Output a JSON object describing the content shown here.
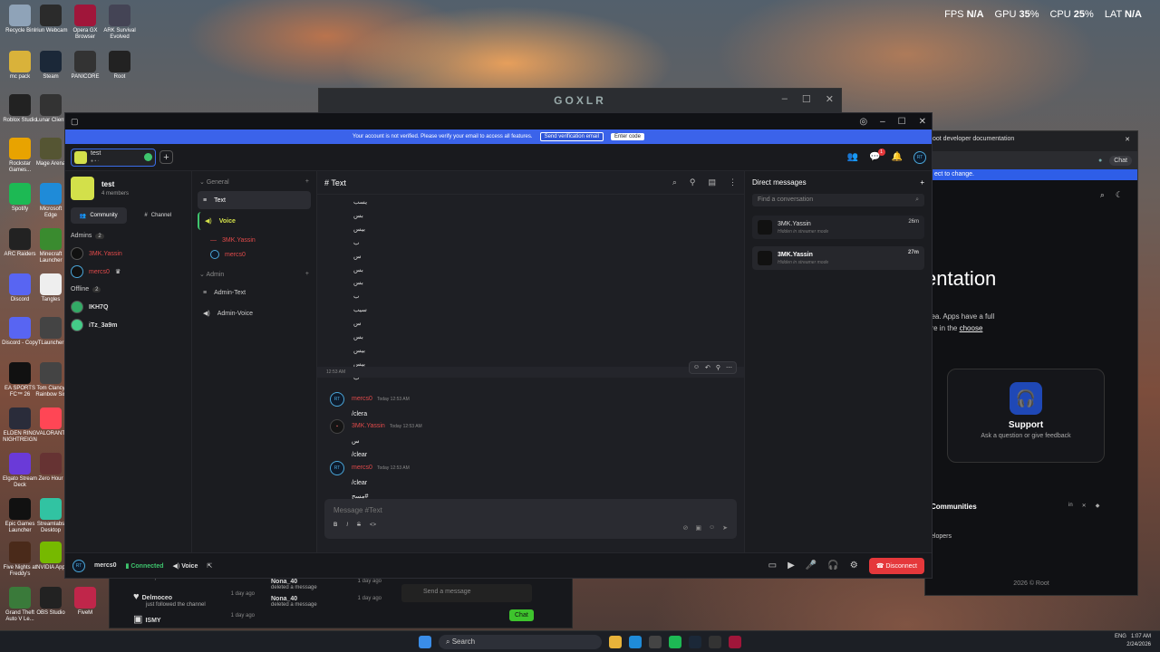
{
  "hud": {
    "fps_label": "FPS",
    "fps": "N/A",
    "gpu_label": "GPU",
    "gpu": "35",
    "cpu_label": "CPU",
    "cpu": "25",
    "lat_label": "LAT",
    "lat": "N/A",
    "pct": "%"
  },
  "desktop": [
    {
      "label": "Recycle Bin",
      "color": "#8fa3b8"
    },
    {
      "label": "Iriun Webcam",
      "color": "#2b2b2b"
    },
    {
      "label": "Opera GX Browser",
      "color": "#a0163a"
    },
    {
      "label": "ARK Survival Evolved",
      "color": "#445"
    },
    {
      "label": "mc pack",
      "color": "#d9b23a"
    },
    {
      "label": "Steam",
      "color": "#1b2838"
    },
    {
      "label": "PANICORE",
      "color": "#333"
    },
    {
      "label": "Root",
      "color": "#222"
    },
    {
      "label": "Roblox Studio",
      "color": "#222"
    },
    {
      "label": "Lunar Client",
      "color": "#333"
    },
    {
      "label": "Rockstar Games...",
      "color": "#e8a300"
    },
    {
      "label": "Mage Arena",
      "color": "#553"
    },
    {
      "label": "Spotify",
      "color": "#1db954"
    },
    {
      "label": "Microsoft Edge",
      "color": "#1f8bd8"
    },
    {
      "label": "ARC Raiders",
      "color": "#222"
    },
    {
      "label": "Minecraft Launcher",
      "color": "#3a8b2f"
    },
    {
      "label": "Discord",
      "color": "#5865f2"
    },
    {
      "label": "Tangles",
      "color": "#eee"
    },
    {
      "label": "Discord - Copy",
      "color": "#5865f2"
    },
    {
      "label": "TLauncher",
      "color": "#444"
    },
    {
      "label": "EA SPORTS FC™ 26",
      "color": "#111"
    },
    {
      "label": "Tom Clancy Rainbow Six",
      "color": "#444"
    },
    {
      "label": "ELDEN RING NIGHTREIGN",
      "color": "#2a2c3a"
    },
    {
      "label": "VALORANT",
      "color": "#ff4655"
    },
    {
      "label": "Elgato Stream Deck",
      "color": "#6a3ad8"
    },
    {
      "label": "Zero Hour",
      "color": "#633"
    },
    {
      "label": "Epic Games Launcher",
      "color": "#111"
    },
    {
      "label": "Streamlabs Desktop",
      "color": "#31c3a2"
    },
    {
      "label": "Five Nights at Freddy's",
      "color": "#4a2a1a"
    },
    {
      "label": "NVIDIA App",
      "color": "#76b900"
    },
    {
      "label": "Grand Theft Auto V Le...",
      "color": "#3a7a3a"
    },
    {
      "label": "OBS Studio",
      "color": "#222"
    },
    {
      "label": "FiveM",
      "color": "#c0264a"
    }
  ],
  "goxlr": {
    "title": "GOXLR"
  },
  "browser": {
    "tab": "oot developer documentation",
    "notice": "ect to change.",
    "heading": "entation",
    "body1": "dea. Apps have a full",
    "body2": "ore in the",
    "body_link": "choose",
    "support_title": "Support",
    "support_sub": "Ask a question or give feedback",
    "communities": "Communities",
    "developers": "elopers",
    "footer": "2026 © Root",
    "chat_label": "Chat"
  },
  "bgapp": {
    "rows": [
      {
        "title": "Delmoceo",
        "sub": "just followed the channel",
        "time": "1 day ago"
      },
      {
        "title": "ISMY",
        "sub": "",
        "time": "1 day ago"
      }
    ],
    "rows2": [
      {
        "title": "Nona_40",
        "sub": "deleted a message",
        "time": "1 day ago"
      },
      {
        "title": "Nona_40",
        "sub": "deleted a message",
        "time": "1 day ago"
      }
    ],
    "placeholder": "Send a message",
    "chat_button": "Chat",
    "cut_text": "just followed the channel"
  },
  "app": {
    "verify_text": "Your account is not verified. Please verify your email to access all features.",
    "send_verify": "Send verification email",
    "enter_code": "Enter code",
    "space": {
      "name": "test",
      "members": "4 members",
      "tab_community": "Community",
      "tab_channel": "Channel"
    },
    "member_sections": [
      {
        "title": "Admins",
        "count": "2"
      },
      {
        "title": "Offline",
        "count": "2"
      }
    ],
    "admins": [
      {
        "name": "3MK.Yassin",
        "color": "#e04a4a"
      },
      {
        "name": "mercs0",
        "color": "#e04a4a"
      }
    ],
    "offline": [
      {
        "name": "IKH7Q",
        "color": "#ddd"
      },
      {
        "name": "iTz_3a9m",
        "color": "#ddd"
      }
    ],
    "categories": [
      {
        "name": "General"
      },
      {
        "name": "Admin"
      }
    ],
    "channels_general": [
      {
        "name": "Text"
      },
      {
        "name": "Voice"
      }
    ],
    "voice_users": [
      {
        "name": "3MK.Yassin"
      },
      {
        "name": "mercs0"
      }
    ],
    "channels_admin": [
      {
        "name": "Admin-Text"
      },
      {
        "name": "Admin-Voice"
      }
    ],
    "chat_title": "# Text",
    "old_messages": [
      "يسب",
      "بس",
      "بيس",
      "ب",
      "س",
      "بس",
      "بس",
      "ب",
      "سيب",
      "س",
      "بس",
      "بيس",
      "بيس",
      "ب"
    ],
    "hover_time": "12:53 AM",
    "messages": [
      {
        "author": "mercs0",
        "time": "Today 12:53 AM",
        "lines": [
          "/clera"
        ]
      },
      {
        "author": "3MK.Yassin",
        "time": "Today 12:53 AM",
        "lines": [
          "س",
          "/clear"
        ]
      },
      {
        "author": "mercs0",
        "time": "Today 12:53 AM",
        "lines": [
          "/clear",
          "مسح#"
        ]
      }
    ],
    "composer_placeholder": "Message #Text",
    "dm_title": "Direct messages",
    "dm_search": "Find a conversation",
    "dms": [
      {
        "name": "3MK.Yassin",
        "status": "Hidden in streamer mode",
        "time": "26m"
      },
      {
        "name": "3MK.Yassin",
        "status": "Hidden in streamer mode",
        "time": "27m"
      }
    ],
    "notif_count": "1",
    "user": "mercs0",
    "connected": "Connected",
    "voice_label": "Voice",
    "disconnect": "Disconnect"
  },
  "taskbar": {
    "search": "Search",
    "lang": "ENG",
    "time": "1:07 AM",
    "date": "2/24/2026"
  }
}
